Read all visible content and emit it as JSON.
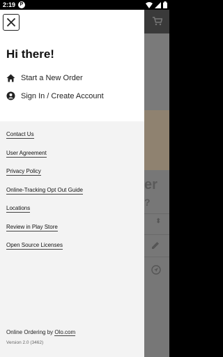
{
  "status_bar": {
    "time": "2:19",
    "notification_badge": "P",
    "icons": [
      "wifi-icon",
      "signal-icon",
      "battery-icon"
    ]
  },
  "background_app": {
    "heading_fragment": "er",
    "subheading_fragment": "?",
    "icons": [
      "cart-icon",
      "edit-icon",
      "navigation-icon"
    ]
  },
  "drawer": {
    "greeting": "Hi there!",
    "menu": [
      {
        "label": "Start a New Order",
        "icon": "home-icon"
      },
      {
        "label": "Sign In / Create Account",
        "icon": "account-icon"
      }
    ],
    "links": [
      "Contact Us",
      "User Agreement",
      "Privacy Policy",
      "Online-Tracking Opt Out Guide",
      "Locations",
      "Review in Play Store",
      "Open Source Licenses"
    ],
    "footer": {
      "prefix": "Online Ordering by ",
      "brand": "Olo.com",
      "version": "Version 2.0 (3462)"
    }
  }
}
